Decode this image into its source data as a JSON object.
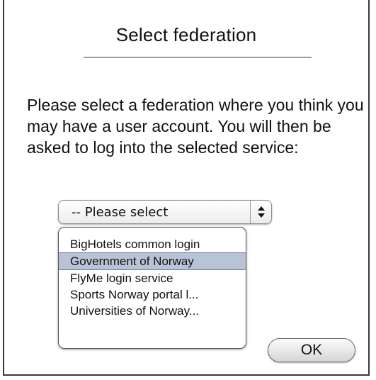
{
  "dialog": {
    "title": "Select federation",
    "description": "Please select a federation where you think you may have a user account. You will then be asked to log into the selected service:"
  },
  "select": {
    "value": "-- Please select",
    "arrows_icon": "up-down-chevron-icon"
  },
  "listbox": {
    "items": [
      {
        "label": "BigHotels common login",
        "selected": false
      },
      {
        "label": "Government of Norway",
        "selected": true
      },
      {
        "label": "FlyMe login service",
        "selected": false
      },
      {
        "label": "Sports Norway portal l...",
        "selected": false
      },
      {
        "label": "Universities of Norway...",
        "selected": false
      }
    ]
  },
  "buttons": {
    "ok_label": "OK"
  },
  "colors": {
    "selection_highlight": "#b9c3d6",
    "border": "#3a3a3a"
  }
}
